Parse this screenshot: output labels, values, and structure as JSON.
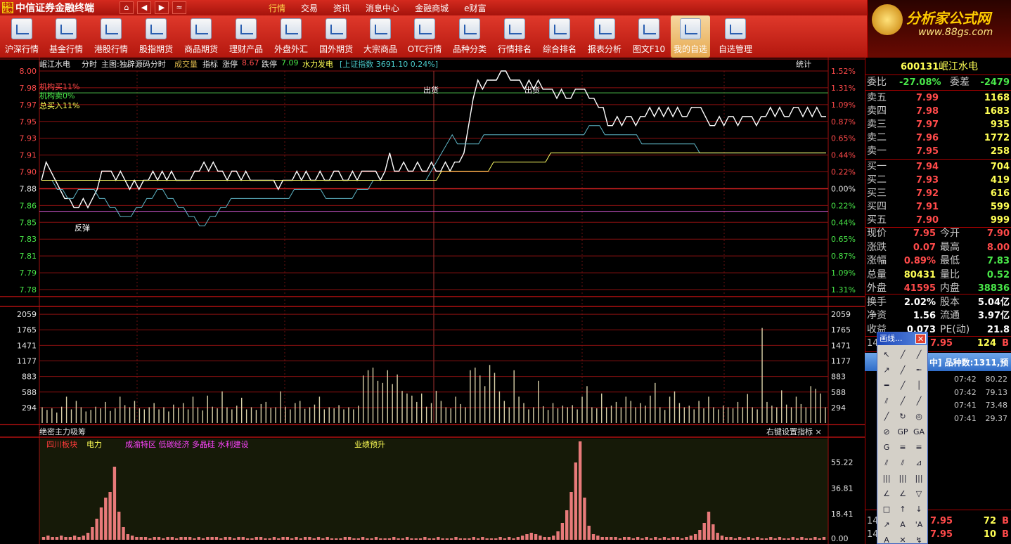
{
  "menubar": {
    "badge": "中信\n证券",
    "title": "中信证券金融终端",
    "nav": [
      "⌂",
      "◀",
      "▶",
      "≈"
    ],
    "items": [
      "行情",
      "交易",
      "资讯",
      "消息中心",
      "金融商城",
      "e财富"
    ]
  },
  "ad": {
    "title": "分析家公式网",
    "url": "www.88gs.com"
  },
  "toolbar": {
    "items": [
      {
        "label": "沪深行情",
        "w": 62
      },
      {
        "label": "基金行情",
        "w": 64
      },
      {
        "label": "港股行情",
        "w": 64
      },
      {
        "label": "股指期货",
        "w": 64
      },
      {
        "label": "商品期货",
        "w": 64
      },
      {
        "label": "理财产品",
        "w": 64
      },
      {
        "label": "外盘外汇",
        "w": 64
      },
      {
        "label": "国外期货",
        "w": 64
      },
      {
        "label": "大宗商品",
        "w": 62
      },
      {
        "label": "OTC行情",
        "w": 64
      },
      {
        "label": "品种分类",
        "w": 64
      },
      {
        "label": "行情排名",
        "w": 64
      },
      {
        "label": "综合排名",
        "w": 64
      },
      {
        "label": "报表分析",
        "w": 64
      },
      {
        "label": "图文F10",
        "w": 62
      },
      {
        "label": "我的自选",
        "w": 56,
        "selected": true
      },
      {
        "label": "自选管理",
        "w": 72
      }
    ]
  },
  "chart_header": {
    "stock": "岷江水电",
    "period": "分时",
    "main": "主图:独辟源码分时",
    "vol": "成交量",
    "indicator": "指标",
    "up_label": "涨停",
    "up_value": "8.67",
    "down_label": "跌停",
    "down_value": "7.09",
    "sector": "水力发电",
    "index": "[上证指数 3691.10 0.24%]",
    "right": "统计"
  },
  "legends": {
    "inst_buy": "机构买11%",
    "inst_sell": "机构卖0%",
    "total_buy": "总买入11%"
  },
  "annotations": {
    "sell1": "出货",
    "sell2": "出货",
    "rebound": "反弹"
  },
  "lower_header": {
    "title": "绝密主力吸筹",
    "right": "右键设置指标 ×",
    "tags": [
      {
        "text": "四川板块",
        "color": "#ff3a3a"
      },
      {
        "text": "电力",
        "color": "#ffff55"
      },
      {
        "text": "成渝特区 低碳经济 多晶硅 水利建设",
        "color": "#ff44ff"
      },
      {
        "text": "业绩预升",
        "color": "#ffff55"
      }
    ]
  },
  "price_axis": {
    "left_labels": [
      "8.00",
      "7.98",
      "7.97",
      "7.95",
      "7.93",
      "7.91",
      "7.90",
      "7.88",
      "7.86",
      "7.85",
      "7.83",
      "7.81",
      "7.79",
      "7.78"
    ],
    "right_labels": [
      "1.52%",
      "1.31%",
      "1.09%",
      "0.87%",
      "0.65%",
      "0.44%",
      "0.22%",
      "0.00%",
      "0.22%",
      "0.44%",
      "0.65%",
      "0.87%",
      "1.09%",
      "1.31%"
    ]
  },
  "volume_axis": {
    "labels": [
      "2059",
      "1765",
      "1471",
      "1177",
      "883",
      "588",
      "294"
    ]
  },
  "lower_axis": {
    "labels": [
      "55.22",
      "36.81",
      "18.41",
      "0.00"
    ]
  },
  "chart_data": [
    {
      "type": "line",
      "name": "intraday price",
      "ylim": [
        7.76,
        8.0
      ],
      "base": 7.88,
      "series": [
        {
          "color": "#ffffff",
          "values": [
            7.88,
            7.9,
            7.89,
            7.88,
            7.87,
            7.86,
            7.86,
            7.85,
            7.85,
            7.86,
            7.85,
            7.86,
            7.87,
            7.89,
            7.89,
            7.89,
            7.88,
            7.89,
            7.88,
            7.87,
            7.88,
            7.87,
            7.88,
            7.88,
            7.89,
            7.88,
            7.89,
            7.88,
            7.89,
            7.88,
            7.88,
            7.88,
            7.88,
            7.89,
            7.89,
            7.9,
            7.89,
            7.9,
            7.89,
            7.89,
            7.88,
            7.89,
            7.89,
            7.88,
            7.89,
            7.88,
            7.88,
            7.88,
            7.88,
            7.88,
            7.88,
            7.87,
            7.88,
            7.88,
            7.88,
            7.89,
            7.88,
            7.89,
            7.88,
            7.88,
            7.89,
            7.88,
            7.88,
            7.89,
            7.89,
            7.88,
            7.88,
            7.89,
            7.88,
            7.89,
            7.89,
            7.89,
            7.89,
            7.88,
            7.89,
            7.91,
            7.89,
            7.89,
            7.9,
            7.89,
            7.89,
            7.9,
            7.89,
            7.89,
            7.9,
            7.89,
            7.89,
            7.9,
            7.89,
            7.9,
            7.9,
            7.91,
            7.94,
            7.97,
            7.99,
            7.98,
            7.99,
            7.99,
            7.99,
            8.0,
            8.0,
            7.99,
            7.99,
            7.99,
            7.98,
            7.99,
            7.98,
            7.99,
            7.98,
            7.98,
            7.98,
            7.97,
            7.98,
            7.97,
            7.97,
            7.98,
            7.98,
            7.98,
            7.97,
            7.97,
            7.96,
            7.96,
            7.94,
            7.94,
            7.95,
            7.94,
            7.95,
            7.95,
            7.94,
            7.95,
            7.95,
            7.96,
            7.95,
            7.96,
            7.95,
            7.96,
            7.95,
            7.96,
            7.95,
            7.95,
            7.96,
            7.96,
            7.96,
            7.95,
            7.94,
            7.94,
            7.95,
            7.94,
            7.95,
            7.95,
            7.94,
            7.95,
            7.95,
            7.95,
            7.94,
            7.95,
            7.95,
            7.96,
            7.95,
            7.96,
            7.95,
            7.95,
            7.96,
            7.96,
            7.95,
            7.96,
            7.95,
            7.96,
            7.95,
            7.95
          ]
        },
        {
          "color": "#5fb7c8",
          "values": [
            7.88,
            7.88,
            7.88,
            7.87,
            7.87,
            7.86,
            7.86,
            7.87,
            7.87,
            7.87,
            7.87,
            7.86,
            7.86,
            7.85,
            7.85,
            7.84,
            7.84,
            7.84,
            7.85,
            7.85,
            7.86,
            7.86,
            7.87,
            7.87,
            7.86,
            7.86,
            7.85,
            7.85,
            7.84,
            7.84,
            7.83,
            7.83,
            7.84,
            7.84,
            7.85,
            7.85,
            7.86,
            7.86,
            7.86,
            7.86,
            7.86,
            7.86,
            7.86,
            7.86,
            7.86,
            7.86,
            7.86,
            7.86,
            7.87,
            7.87,
            7.87,
            7.87,
            7.87,
            7.87,
            7.86,
            7.86,
            7.86,
            7.86,
            7.86,
            7.86,
            7.87,
            7.87,
            7.87,
            7.88,
            7.88,
            7.88,
            7.88,
            7.88,
            7.88,
            7.88,
            7.88,
            7.88,
            7.88,
            7.88,
            7.89,
            7.9,
            7.91,
            7.92,
            7.93,
            7.92,
            7.92,
            7.92,
            7.92,
            7.92,
            7.93,
            7.93,
            7.93,
            7.93,
            7.93,
            7.93,
            7.93,
            7.93,
            7.93,
            7.93,
            7.93,
            7.93,
            7.93,
            7.93,
            7.93,
            7.93,
            7.93,
            7.93,
            7.93,
            7.93,
            7.94,
            7.94,
            7.94,
            7.93,
            7.93,
            7.93,
            7.93,
            7.93,
            7.93,
            7.93,
            7.92,
            7.92,
            7.92,
            7.92,
            7.92,
            7.92,
            7.92,
            7.92,
            7.92,
            7.92,
            7.92,
            7.91,
            7.91,
            7.91,
            7.91,
            7.91,
            7.91,
            7.91,
            7.91,
            7.91,
            7.91,
            7.91,
            7.91,
            7.91,
            7.91,
            7.91,
            7.91,
            7.91,
            7.91,
            7.91,
            7.91,
            7.91,
            7.91,
            7.91,
            7.91,
            7.91
          ]
        },
        {
          "color": "#ffff66",
          "values": [
            7.88,
            7.88,
            7.88,
            7.88,
            7.88,
            7.88,
            7.88,
            7.88,
            7.88,
            7.88,
            7.88,
            7.88,
            7.88,
            7.88,
            7.88,
            7.88,
            7.88,
            7.88,
            7.88,
            7.88,
            7.88,
            7.88,
            7.88,
            7.88,
            7.88,
            7.88,
            7.88,
            7.88,
            7.88,
            7.88,
            7.88,
            7.88,
            7.88,
            7.88,
            7.88,
            7.88,
            7.88,
            7.88,
            7.88,
            7.88,
            7.88,
            7.88,
            7.88,
            7.88,
            7.88,
            7.88,
            7.88,
            7.88,
            7.88,
            7.88,
            7.88,
            7.88,
            7.88,
            7.88,
            7.88,
            7.88,
            7.88,
            7.88,
            7.88,
            7.88,
            7.88,
            7.88,
            7.88,
            7.88,
            7.88,
            7.88,
            7.88,
            7.88,
            7.88,
            7.88,
            7.88,
            7.88,
            7.88,
            7.88,
            7.88,
            7.88,
            7.88,
            7.89,
            7.89,
            7.89,
            7.89,
            7.89,
            7.89,
            7.89,
            7.89,
            7.89,
            7.89,
            7.9,
            7.9,
            7.9,
            7.9,
            7.9,
            7.9,
            7.9,
            7.9,
            7.9,
            7.9,
            7.9,
            7.91,
            7.91,
            7.91,
            7.91,
            7.91,
            7.91,
            7.91,
            7.91,
            7.91,
            7.91,
            7.91,
            7.91,
            7.91,
            7.91,
            7.91,
            7.91,
            7.91,
            7.91,
            7.91,
            7.91,
            7.91,
            7.91,
            7.91,
            7.91,
            7.91,
            7.91,
            7.91,
            7.91,
            7.91,
            7.91,
            7.91,
            7.91,
            7.91,
            7.91,
            7.91,
            7.91,
            7.91,
            7.91,
            7.91,
            7.91,
            7.91,
            7.91,
            7.91,
            7.91,
            7.91,
            7.91,
            7.91,
            7.91,
            7.91,
            7.91,
            7.91,
            7.91,
            7.91,
            7.91
          ]
        }
      ],
      "hlines": [
        {
          "value": 7.976,
          "color": "#3c9a3c"
        },
        {
          "value": 7.846,
          "color": "#c050c0"
        }
      ]
    },
    {
      "type": "bar",
      "name": "volume",
      "ylim": [
        0,
        2353
      ],
      "values": [
        300,
        250,
        280,
        200,
        310,
        500,
        260,
        420,
        300,
        220,
        250,
        310,
        280,
        400,
        230,
        280,
        500,
        340,
        300,
        420,
        280,
        260,
        300,
        380,
        260,
        300,
        220,
        350,
        290,
        380,
        260,
        500,
        300,
        240,
        520,
        310,
        280,
        600,
        300,
        260,
        330,
        480,
        260,
        300,
        250,
        360,
        400,
        290,
        300,
        600,
        310,
        260,
        380,
        420,
        270,
        300,
        350,
        500,
        260,
        300,
        280,
        340,
        260,
        300,
        260,
        330,
        900,
        1000,
        1050,
        800,
        760,
        1000,
        740,
        920,
        610,
        560,
        520,
        400,
        560,
        310,
        380,
        610,
        420,
        300,
        280,
        500,
        360,
        300,
        1000,
        1050,
        900,
        700,
        1100,
        950,
        600,
        420,
        300,
        1000,
        500,
        380,
        260,
        300,
        800,
        320,
        250,
        380,
        280,
        330,
        300,
        340,
        260,
        500,
        700,
        300,
        280,
        560,
        300,
        330,
        400,
        300,
        500,
        420,
        300,
        380,
        330,
        520,
        760,
        300,
        250,
        500,
        600,
        380,
        300,
        330,
        260,
        420,
        280,
        500,
        300,
        260,
        330,
        300,
        280,
        400,
        300,
        550,
        300,
        260,
        1800,
        400,
        330,
        300,
        620,
        350,
        300,
        500,
        360,
        300,
        700,
        650,
        560,
        300
      ]
    },
    {
      "type": "bar",
      "name": "lower indicator",
      "ylim": [
        0,
        72
      ],
      "values": [
        2,
        3,
        2,
        2,
        3,
        2,
        2,
        3,
        2,
        3,
        5,
        9,
        15,
        23,
        30,
        34,
        52,
        20,
        9,
        4,
        3,
        2,
        2,
        2,
        1,
        2,
        2,
        1,
        2,
        2,
        1,
        2,
        2,
        2,
        1,
        2,
        1,
        2,
        2,
        2,
        1,
        2,
        2,
        1,
        2,
        2,
        1,
        1,
        2,
        2,
        1,
        1,
        2,
        1,
        2,
        2,
        1,
        2,
        1,
        2,
        2,
        1,
        2,
        1,
        2,
        1,
        1,
        1,
        2,
        2,
        1,
        1,
        2,
        1,
        1,
        2,
        1,
        1,
        1,
        2,
        1,
        1,
        2,
        1,
        1,
        1,
        2,
        1,
        1,
        2,
        1,
        1,
        1,
        2,
        1,
        1,
        1,
        2,
        1,
        2,
        1,
        1,
        1,
        2,
        1,
        2,
        1,
        2,
        3,
        4,
        5,
        4,
        3,
        2,
        2,
        3,
        6,
        12,
        21,
        34,
        55,
        70,
        30,
        10,
        4,
        3,
        2,
        2,
        2,
        2,
        1,
        2,
        2,
        1,
        2,
        1,
        2,
        1,
        2,
        1,
        2,
        1,
        2,
        2,
        1,
        2,
        3,
        4,
        7,
        12,
        20,
        11,
        5,
        3,
        2,
        2,
        1,
        2,
        1,
        2,
        1,
        2,
        1,
        1,
        2,
        1,
        2,
        1,
        1,
        2,
        1,
        2,
        1,
        1,
        2,
        1,
        2
      ]
    }
  ],
  "panel": {
    "code": "600131",
    "name": "岷江水电",
    "wb_label": "委比",
    "wb_value": "-27.08%",
    "wc_label": "委差",
    "wc_value": "-2479",
    "sells": [
      {
        "label": "卖五",
        "price": "7.99",
        "vol": "1168"
      },
      {
        "label": "卖四",
        "price": "7.98",
        "vol": "1683"
      },
      {
        "label": "卖三",
        "price": "7.97",
        "vol": "935"
      },
      {
        "label": "卖二",
        "price": "7.96",
        "vol": "1772"
      },
      {
        "label": "卖一",
        "price": "7.95",
        "vol": "258"
      }
    ],
    "buys": [
      {
        "label": "买一",
        "price": "7.94",
        "vol": "704"
      },
      {
        "label": "买二",
        "price": "7.93",
        "vol": "419"
      },
      {
        "label": "买三",
        "price": "7.92",
        "vol": "616"
      },
      {
        "label": "买四",
        "price": "7.91",
        "vol": "599"
      },
      {
        "label": "买五",
        "price": "7.90",
        "vol": "999"
      }
    ],
    "stats": [
      {
        "l1": "现价",
        "v1": "7.95",
        "c1": "#ff4a4a",
        "l2": "今开",
        "v2": "7.90",
        "c2": "#ff4a4a"
      },
      {
        "l1": "涨跌",
        "v1": "0.07",
        "c1": "#ff4a4a",
        "l2": "最高",
        "v2": "8.00",
        "c2": "#ff4a4a"
      },
      {
        "l1": "涨幅",
        "v1": "0.89%",
        "c1": "#ff4a4a",
        "l2": "最低",
        "v2": "7.83",
        "c2": "#49e849"
      },
      {
        "l1": "总量",
        "v1": "80431",
        "c1": "#ffff55",
        "l2": "量比",
        "v2": "0.52",
        "c2": "#49e849"
      },
      {
        "l1": "外盘",
        "v1": "41595",
        "c1": "#ff4a4a",
        "l2": "内盘",
        "v2": "38836",
        "c2": "#49e849"
      },
      {
        "l1": "换手",
        "v1": "2.02%",
        "c1": "#ffffff",
        "l2": "股本",
        "v2": "5.04亿",
        "c2": "#ffffff"
      },
      {
        "l1": "净资",
        "v1": "1.56",
        "c1": "#ffffff",
        "l2": "流通",
        "v2": "3.97亿",
        "c2": "#ffffff"
      },
      {
        "l1": "收益",
        "v1": "0.073",
        "c1": "#ffffff",
        "l2": "PE(动)",
        "v2": "21.8",
        "c2": "#ffffff"
      }
    ],
    "tick_top": {
      "time": "14",
      "price": "7.95",
      "vol": "124",
      "flag": "B"
    },
    "bluebar": "中] 品种数:1311,预",
    "rank_rows": [
      {
        "time": "07:42",
        "val": "80.22"
      },
      {
        "time": "07:42",
        "val": "79.13"
      },
      {
        "time": "07:41",
        "val": "73.48"
      },
      {
        "time": "07:41",
        "val": "29.37"
      }
    ],
    "ticks_bottom": [
      {
        "time": "14",
        "price": "7.95",
        "vol": "72",
        "flag": "B"
      },
      {
        "time": "14",
        "price": "7.95",
        "vol": "10",
        "flag": "B"
      }
    ]
  },
  "palette": {
    "title": "画线...",
    "close": "✕",
    "tools": [
      "↖",
      "╱",
      "╱",
      "↗",
      "╱",
      "╾",
      "━",
      "╱",
      "│",
      "⫽",
      "╱",
      "╱",
      "╱",
      "↻",
      "◎",
      "⊘",
      "GP",
      "GA",
      "G",
      "≡",
      "≡",
      "⫽",
      "⫽",
      "⊿",
      "|||",
      "|||",
      "|||",
      "∠",
      "∠",
      "▽",
      "□",
      "↑",
      "↓",
      "↗",
      "A",
      "'A",
      "A",
      "✕",
      "↯"
    ]
  }
}
